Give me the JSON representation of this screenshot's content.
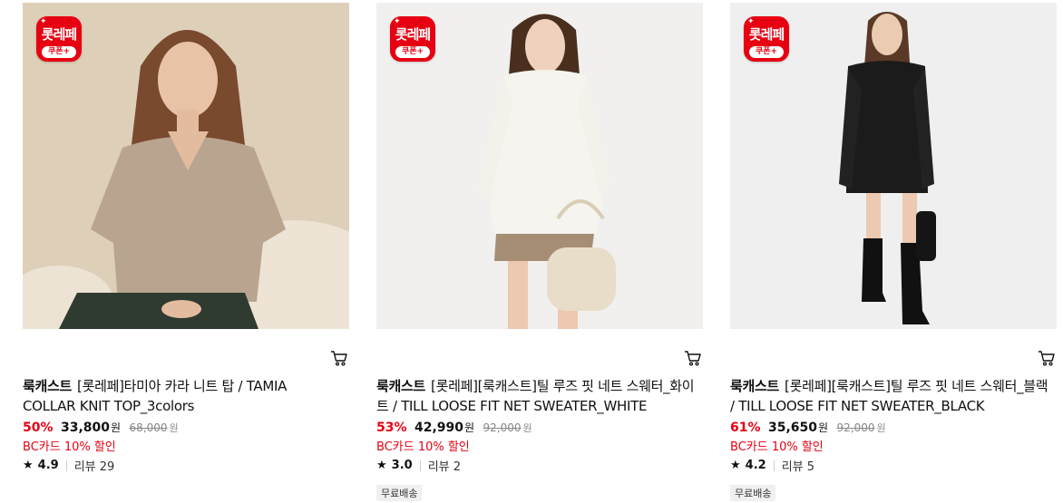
{
  "badge": {
    "top": "롯레페",
    "bottom": "쿠폰+",
    "sparkle": "✦"
  },
  "colors": {
    "accent": "#e60012"
  },
  "products": [
    {
      "brand": "룩캐스트",
      "name": "[롯레페]타미아 카라 니트 탑 / TAMIA COLLAR KNIT TOP_3colors",
      "discount": "50%",
      "price": "33,800",
      "currency": "원",
      "original_price": "68,000",
      "promo": "BC카드 10% 할인",
      "rating": "4.9",
      "reviews": "리뷰 29",
      "tag": ""
    },
    {
      "brand": "룩캐스트",
      "name": "[롯레페][룩캐스트]틸 루즈 핏 네트 스웨터_화이트 / TILL LOOSE FIT NET SWEATER_WHITE",
      "discount": "53%",
      "price": "42,990",
      "currency": "원",
      "original_price": "92,000",
      "promo": "BC카드 10% 할인",
      "rating": "3.0",
      "reviews": "리뷰 2",
      "tag": "무료배송"
    },
    {
      "brand": "룩캐스트",
      "name": "[롯레페][룩캐스트]틸 루즈 핏 네트 스웨터_블랙 / TILL LOOSE FIT NET SWEATER_BLACK",
      "discount": "61%",
      "price": "35,650",
      "currency": "원",
      "original_price": "92,000",
      "promo": "BC카드 10% 할인",
      "rating": "4.2",
      "reviews": "리뷰 5",
      "tag": "무료배송"
    }
  ],
  "icons": {
    "cart": "cart-icon",
    "star": "star-icon",
    "badge": "lotte-coupon-badge"
  }
}
